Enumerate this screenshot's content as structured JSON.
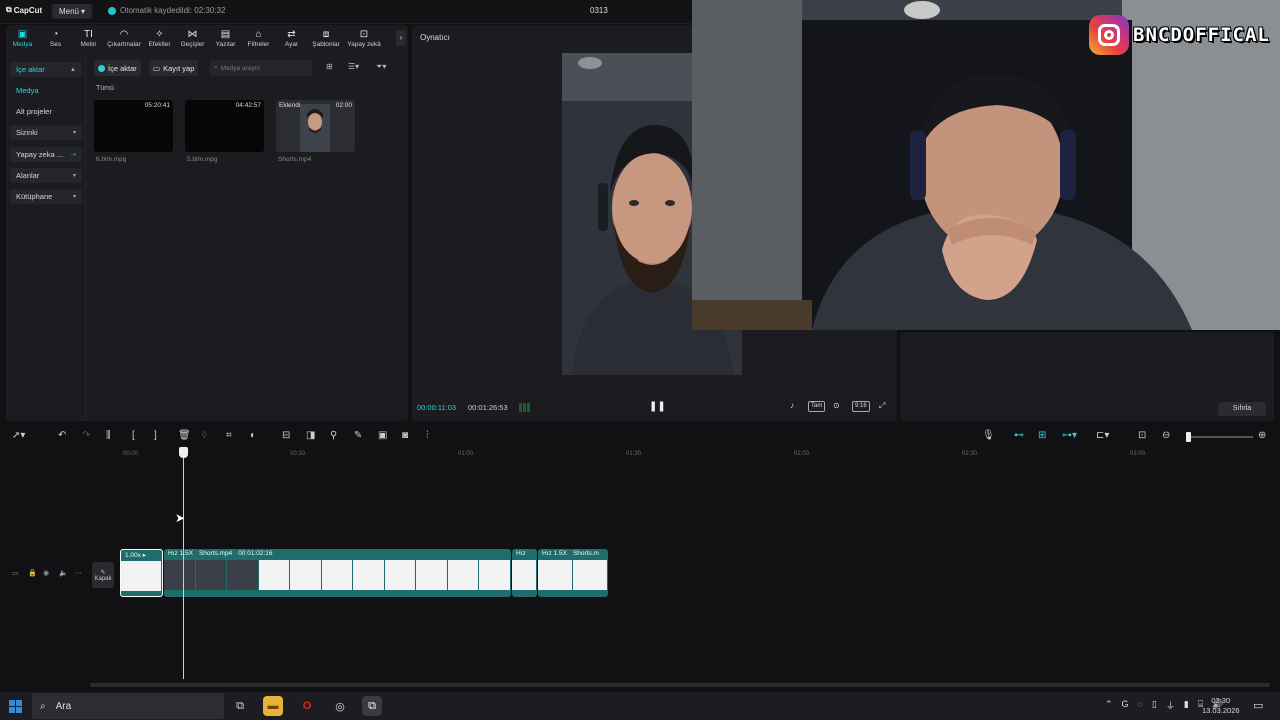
{
  "app": {
    "logo": "CapCut",
    "menu_label": "Menü",
    "autosave": "Otomatik kaydedildi: 02:30:32",
    "project_title": "0313"
  },
  "tool_tabs": [
    {
      "label": "Medya",
      "icon": "media-icon"
    },
    {
      "label": "Ses",
      "icon": "audio-icon"
    },
    {
      "label": "Metin",
      "icon": "text-icon"
    },
    {
      "label": "Çıkartmalar",
      "icon": "sticker-icon"
    },
    {
      "label": "Efektler",
      "icon": "effects-icon"
    },
    {
      "label": "Geçişler",
      "icon": "transitions-icon"
    },
    {
      "label": "Yazılar",
      "icon": "captions-icon"
    },
    {
      "label": "Filtreler",
      "icon": "filters-icon"
    },
    {
      "label": "Ayar",
      "icon": "adjust-icon"
    },
    {
      "label": "Şablonlar",
      "icon": "templates-icon"
    },
    {
      "label": "Yapay zekâ",
      "icon": "ai-icon"
    }
  ],
  "side_nav": [
    {
      "label": "İçe aktar",
      "chev": "▲"
    },
    {
      "label": "Medya",
      "chev": ""
    },
    {
      "label": "Alt projeler",
      "chev": ""
    },
    {
      "label": "Sizinki",
      "chev": "▾"
    },
    {
      "label": "Yapay zeka ...",
      "chev": "⇢"
    },
    {
      "label": "Alanlar",
      "chev": "▾"
    },
    {
      "label": "Kütüphane",
      "chev": "▾"
    }
  ],
  "media_toolbar": {
    "import_label": "İçe aktar",
    "record_label": "Kayıt yap",
    "search_placeholder": "Medya arayın"
  },
  "media": {
    "all_label": "Tümü",
    "clips": [
      {
        "name": "6.blm.mpg",
        "duration": "05:20:41",
        "added": ""
      },
      {
        "name": "5.blm.mpg",
        "duration": "04:42:57",
        "added": ""
      },
      {
        "name": "Shorts.mp4",
        "duration": "02:00",
        "added": "Eklendi"
      }
    ]
  },
  "player": {
    "title": "Oynatıcı",
    "current_time": "00:00:11:03",
    "total_time": "00:01:26:53",
    "full_label": "Tam",
    "ratio_label": "9:16"
  },
  "properties": {
    "reset_label": "Sıfırla"
  },
  "overlay": {
    "handle": "BNCDOFFICAL"
  },
  "timeline": {
    "ruler": [
      "00:00",
      "00:30",
      "01:00",
      "01:30",
      "02:00",
      "02:30",
      "03:00"
    ],
    "cover_label": "Kapak",
    "segments": [
      {
        "speed": "1.00x ▸",
        "name": "",
        "duration": ""
      },
      {
        "speed": "Hız 1.5X",
        "name": "Shorts.mp4",
        "duration": "00:01:02:16"
      },
      {
        "speed": "Hız",
        "name": "",
        "duration": ""
      },
      {
        "speed": "Hız 1.5X",
        "name": "Shorts.m",
        "duration": ""
      }
    ]
  },
  "taskbar": {
    "search_label": "Ara",
    "time": "02:30",
    "date": "13.03.2026"
  }
}
